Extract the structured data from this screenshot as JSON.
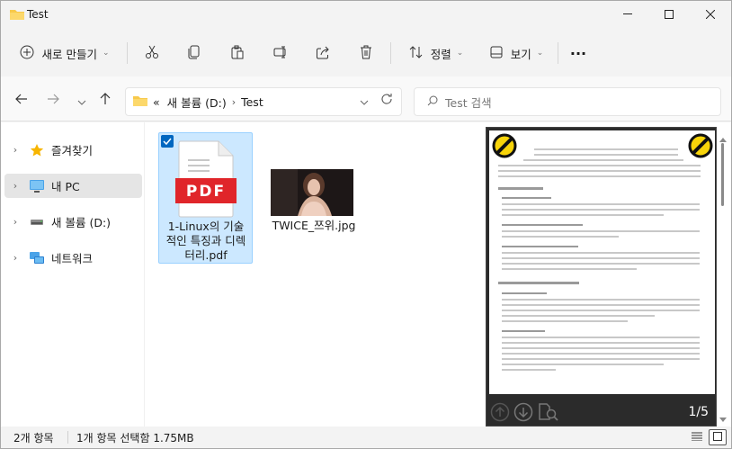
{
  "window": {
    "title": "Test"
  },
  "toolbar": {
    "new_label": "새로 만들기",
    "sort_label": "정렬",
    "view_label": "보기",
    "more_label": "···"
  },
  "address": {
    "overflow": "«",
    "segments": [
      "새 볼륨 (D:)",
      "Test"
    ]
  },
  "search": {
    "placeholder": "Test 검색"
  },
  "sidebar": {
    "items": [
      {
        "label": "즐겨찾기",
        "icon": "star-icon"
      },
      {
        "label": "내 PC",
        "icon": "pc-icon"
      },
      {
        "label": "새 볼륨 (D:)",
        "icon": "drive-icon"
      },
      {
        "label": "네트워크",
        "icon": "network-icon"
      }
    ]
  },
  "files": [
    {
      "name": "1-Linux의 기술 적인 특징과 디렉터리.pdf",
      "type": "pdf",
      "badge": "PDF",
      "selected": true
    },
    {
      "name": "TWICE_쯔위.jpg",
      "type": "jpg",
      "selected": false
    }
  ],
  "preview": {
    "page_indicator": "1/5"
  },
  "status": {
    "item_count": "2개 항목",
    "selection": "1개 항목 선택함 1.75MB"
  },
  "colors": {
    "accent": "#0067c0",
    "selection_bg": "#cce8ff",
    "pdf_red": "#e0252a",
    "folder_yellow": "#f8c94a"
  }
}
